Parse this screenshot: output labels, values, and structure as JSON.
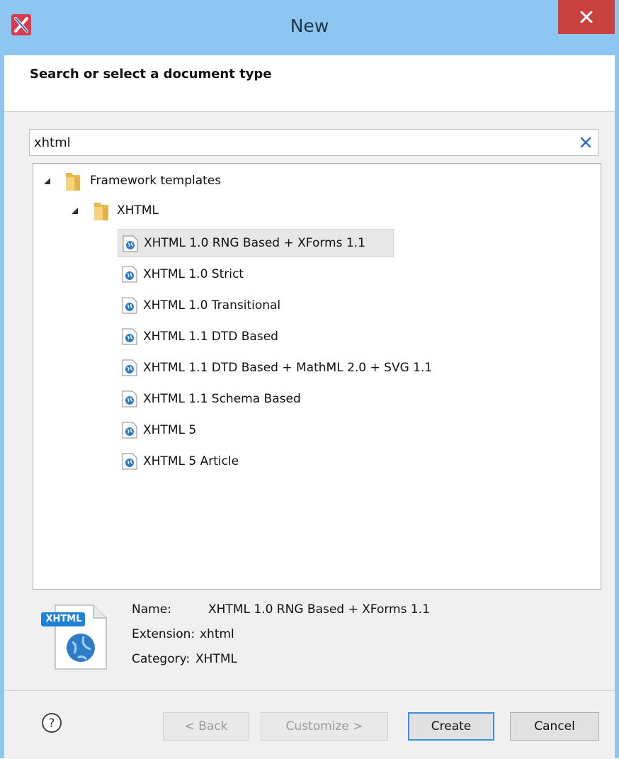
{
  "window": {
    "title": "New"
  },
  "header": {
    "text": "Search or select a document type"
  },
  "search": {
    "value": "xhtml",
    "placeholder": ""
  },
  "tree": {
    "root": {
      "label": "Framework templates"
    },
    "group": {
      "label": "XHTML"
    },
    "items": [
      {
        "label": "XHTML 1.0 RNG Based + XForms 1.1",
        "selected": true
      },
      {
        "label": "XHTML 1.0 Strict"
      },
      {
        "label": "XHTML 1.0 Transitional"
      },
      {
        "label": "XHTML 1.1 DTD Based"
      },
      {
        "label": "XHTML 1.1 DTD Based + MathML 2.0 + SVG 1.1"
      },
      {
        "label": "XHTML 1.1 Schema Based"
      },
      {
        "label": "XHTML 5"
      },
      {
        "label": "XHTML 5 Article"
      }
    ]
  },
  "details": {
    "icon_badge": "XHTML",
    "name_label": "Name:",
    "name_value": "XHTML 1.0 RNG Based + XForms 1.1",
    "extension_label": "Extension:",
    "extension_value": "xhtml",
    "category_label": "Category:",
    "category_value": "XHTML"
  },
  "buttons": {
    "back": "< Back",
    "customize": "Customize >",
    "create": "Create",
    "cancel": "Cancel"
  },
  "colors": {
    "title_bar": "#8ec6f2",
    "close": "#c7413f",
    "accent": "#3c8fdc"
  }
}
